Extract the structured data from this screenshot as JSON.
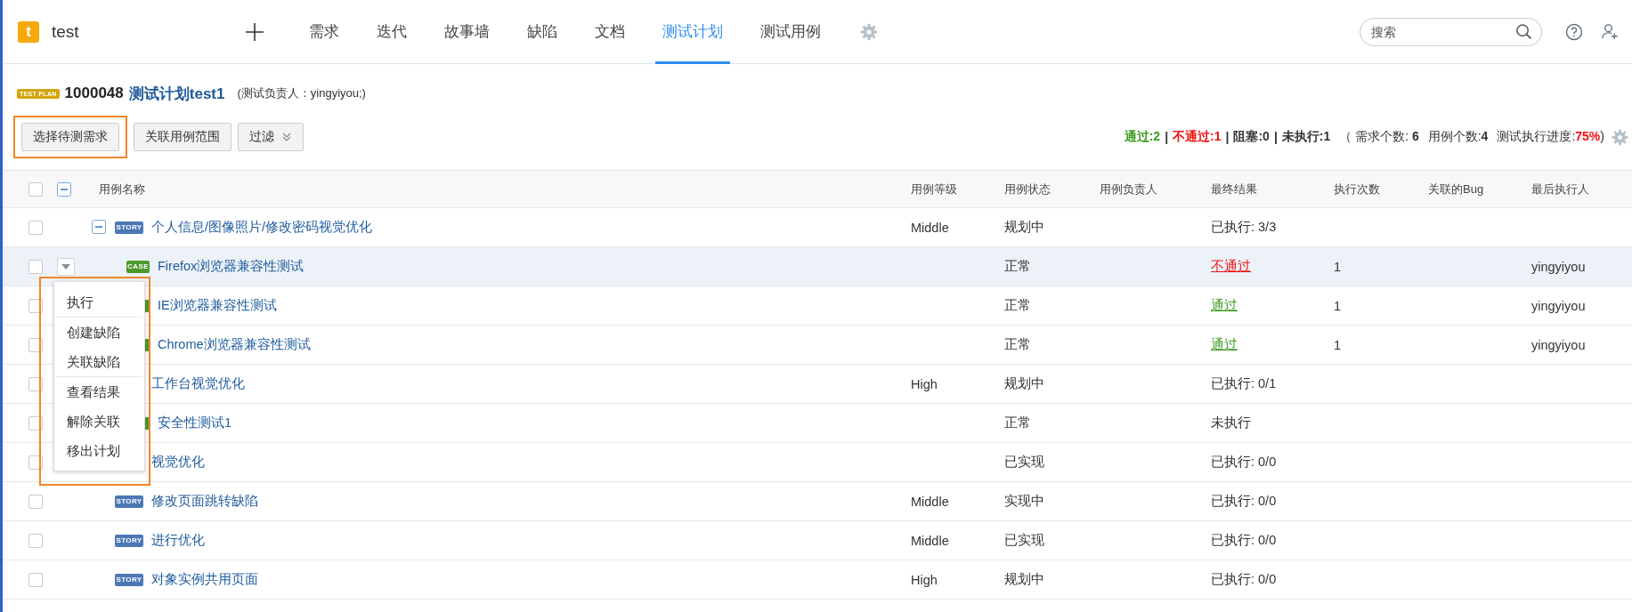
{
  "app": {
    "logo_letter": "t",
    "project": "test"
  },
  "nav": {
    "tabs": [
      {
        "label": "需求",
        "selected": false
      },
      {
        "label": "迭代",
        "selected": false
      },
      {
        "label": "故事墙",
        "selected": false
      },
      {
        "label": "缺陷",
        "selected": false
      },
      {
        "label": "文档",
        "selected": false
      },
      {
        "label": "测试计划",
        "selected": true
      },
      {
        "label": "测试用例",
        "selected": false
      }
    ]
  },
  "search": {
    "placeholder": "搜索"
  },
  "plan": {
    "badge": "TEST PLAN",
    "id": "1000048",
    "title": "测试计划test1",
    "owner": "(测试负责人：yingyiyou;)"
  },
  "buttons": [
    {
      "label": "选择待测需求",
      "annotated": true,
      "kind": "plain"
    },
    {
      "label": "关联用例范围",
      "annotated": false,
      "kind": "plain"
    },
    {
      "label": "过滤",
      "annotated": false,
      "kind": "dropdown"
    }
  ],
  "stats": [
    {
      "text": "通过:2",
      "kind": "pass"
    },
    {
      "text": "|",
      "kind": "sep"
    },
    {
      "text": "不通过:1",
      "kind": "fail"
    },
    {
      "text": "|",
      "kind": "sep"
    },
    {
      "text": "阻塞:0",
      "kind": "muted"
    },
    {
      "text": "|",
      "kind": "sep"
    },
    {
      "text": "未执行:1",
      "kind": "strong"
    },
    {
      "text": "（ 需求个数: **6**",
      "kind": "plain"
    },
    {
      "text": "用例个数:**4**",
      "kind": "plain"
    },
    {
      "text": "测试执行进度:**75%**)",
      "kind": "progress"
    }
  ],
  "table": {
    "columns": [
      "用例名称",
      "用例等级",
      "用例状态",
      "用例负责人",
      "最终结果",
      "执行次数",
      "关联的Bug",
      "最后执行人"
    ],
    "header_checked": false,
    "rows": [
      {
        "tag": "STORY",
        "kind": "story",
        "expanded": true,
        "name": "个人信息/图像照片/修改密码视觉优化",
        "level": "Middle",
        "status": "规划中",
        "result": "已执行: 3/3",
        "color": "#333333",
        "checked": false,
        "selected": false,
        "children": [
          {
            "tag": "CASE",
            "kind": "case",
            "name": "Firefox浏览器兼容性测试",
            "status": "正常",
            "result": "不通过",
            "color": "#f01010",
            "runs": "1",
            "executor": "yingyiyou",
            "checked": false,
            "selected": true
          },
          {
            "kind": "case",
            "name": "IE浏览器兼容性测试",
            "status": "正常",
            "result": "通过",
            "color": "#3d9a1e",
            "runs": "1",
            "executor": "yingyiyou",
            "checked": false,
            "selected": false
          },
          {
            "kind": "case",
            "name": "Chrome浏览器兼容性测试",
            "status": "正常",
            "result": "通过",
            "color": "#3d9a1e",
            "runs": "1",
            "executor": "yingyiyou",
            "checked": false,
            "selected": false
          }
        ]
      },
      {
        "kind": "story",
        "name": "工作台视觉优化",
        "level": "High",
        "status": "规划中",
        "result": "已执行: 0/1",
        "color": "#333333",
        "checked": false,
        "selected": false,
        "children": [
          {
            "kind": "case",
            "name": "安全性测试1",
            "status": "正常",
            "result": "未执行",
            "color": "#333333",
            "checked": false,
            "selected": false
          }
        ]
      },
      {
        "kind": "story",
        "name": "视觉优化",
        "status": "已实现",
        "result": "已执行: 0/0",
        "color": "#333333",
        "checked": false,
        "selected": false
      },
      {
        "tag": "STORY",
        "kind": "story",
        "name": "修改页面跳转缺陷",
        "level": "Middle",
        "status": "实现中",
        "result": "已执行: 0/0",
        "color": "#333333",
        "checked": false,
        "selected": false
      },
      {
        "tag": "STORY",
        "kind": "story",
        "name": "进行优化",
        "level": "Middle",
        "status": "已实现",
        "result": "已执行: 0/0",
        "color": "#333333",
        "checked": false,
        "selected": false
      },
      {
        "tag": "STORY",
        "kind": "story",
        "name": "对象实例共用页面",
        "level": "High",
        "status": "规划中",
        "result": "已执行: 0/0",
        "color": "#333333",
        "checked": false,
        "selected": false
      }
    ]
  },
  "row_menu": {
    "annotated": true,
    "groups": [
      {
        "items": [
          "执行"
        ]
      },
      {
        "items": [
          "创建缺陷",
          "关联缺陷"
        ]
      },
      {
        "items": [
          "查看结果",
          "解除关联",
          "移出计划"
        ]
      }
    ]
  }
}
